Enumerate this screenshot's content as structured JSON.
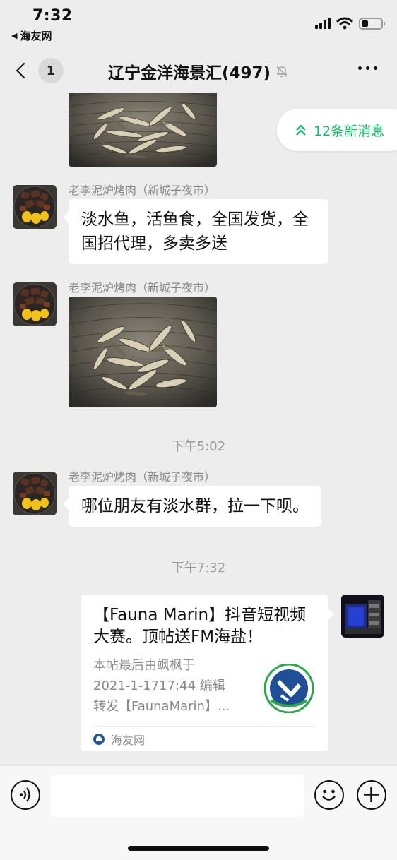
{
  "status_bar": {
    "time": "7:32",
    "back_app": "海友网"
  },
  "nav": {
    "unread_count": "1",
    "title": "辽宁金洋海景汇(497)"
  },
  "new_messages": {
    "label": "12条新消息"
  },
  "messages": [
    {
      "sender": "老李泥炉烤肉（新城子夜市）",
      "text": "淡水鱼，活鱼食，全国发货，全国招代理，多卖多送"
    },
    {
      "sender": "老李泥炉烤肉（新城子夜市）"
    },
    {
      "sender": "老李泥炉烤肉（新城子夜市）",
      "text": "哪位朋友有淡水群，拉一下呗。"
    }
  ],
  "timestamps": [
    "下午5:02",
    "下午7:32"
  ],
  "link_card": {
    "title": "【Fauna Marin】抖音短视频大赛。顶帖送FM海盐！",
    "desc_line1": "本帖最后由飒枫于",
    "desc_line2": "2021-1-1717:44 编辑",
    "desc_line3": "转发【FaunaMarin】...",
    "source": "海友网"
  },
  "input": {
    "placeholder": ""
  },
  "colors": {
    "accent": "#07c160",
    "background": "#ededed",
    "bubble": "#ffffff"
  },
  "icons": [
    "signal-icon",
    "wifi-icon",
    "battery-icon",
    "mute-bell-icon",
    "more-icon",
    "double-chevron-up-icon",
    "voice-icon",
    "emoji-icon",
    "plus-icon"
  ]
}
